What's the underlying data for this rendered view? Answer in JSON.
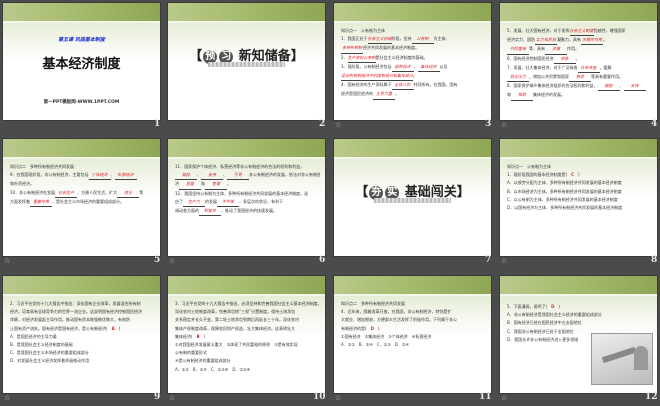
{
  "slides": [
    {
      "number": "1",
      "type": "title",
      "subtitle": "第五课 巩固基本制度",
      "title": "基本经济制度",
      "footer": "第一PPT模板网-WWW.1PPT.COM",
      "anim": false
    },
    {
      "number": "2",
      "type": "section",
      "left": "【",
      "c1": "预",
      "c2": "习",
      "title": "新知储备】",
      "anim": false
    },
    {
      "number": "3",
      "type": "text",
      "anim": true,
      "lines": [
        [
          {
            "t": "知识点一　公有制为主体"
          }
        ],
        [
          {
            "t": "1．我国正处于"
          },
          {
            "a": "社会主义初级"
          },
          {
            "t": "阶段，坚持"
          },
          {
            "a": "公有制"
          },
          {
            "t": "为主体、"
          }
        ],
        [
          {
            "a": "多种所有制"
          },
          {
            "t": "经济共同发展的基本经济制度。"
          }
        ],
        [
          {
            "t": "2．"
          },
          {
            "a": "生产资料公有制"
          },
          {
            "t": "是社会主义经济制度的基础。"
          }
        ],
        [
          {
            "t": "3．现阶段，公有制经济包括"
          },
          {
            "a": "国有经济"
          },
          {
            "t": "、"
          },
          {
            "a": "集体经济"
          },
          {
            "t": "以及"
          }
        ],
        [
          {
            "a": "混合所有制经济中的国有成分和集体成分"
          },
          {
            "t": "。"
          }
        ],
        [
          {
            "t": "4．国有经济的生产资料属于"
          },
          {
            "a": "全体人民"
          },
          {
            "t": "共同所有。在我国，国有"
          }
        ],
        [
          {
            "t": "经济是国民经济的"
          },
          {
            "a": "主导力量"
          },
          {
            "t": "。"
          }
        ]
      ]
    },
    {
      "number": "4",
      "type": "text",
      "anim": true,
      "lines": [
        [
          {
            "t": "5．发展、壮大国有经济，对于发挥"
          },
          {
            "a": "社会主义制度"
          },
          {
            "t": "优越性，增强国家"
          }
        ],
        [
          {
            "t": "经济实力、国防"
          },
          {
            "a": "实力和民族"
          },
          {
            "t": "凝聚力，具有"
          },
          {
            "a": "关键性作用"
          },
          {
            "t": "。"
          }
        ],
        [
          {
            "a": "共同富裕"
          },
          {
            "t": "等，具有"
          },
          {
            "a": "关键"
          },
          {
            "t": "作用。"
          }
        ],
        [
          {
            "t": "6．国有经济控制国民经济"
          },
          {
            "a": "命脉"
          },
          {
            "t": "。"
          }
        ],
        [
          {
            "t": "7．发展、壮大集体经济，对于广泛吸收"
          },
          {
            "a": "社会资金"
          },
          {
            "t": "，缓解"
          }
        ],
        [
          {
            "a": "就业压力"
          },
          {
            "t": "，增加公共积累和国家"
          },
          {
            "a": "税收"
          },
          {
            "t": "等具有重要作用。"
          }
        ],
        [
          {
            "t": "8．国家保护城乡集体经济组织的合法权利和利益，"
          },
          {
            "a": "鼓励"
          },
          {
            "t": "、"
          },
          {
            "a": "支持"
          }
        ],
        [
          {
            "t": "和"
          },
          {
            "a": "帮助"
          },
          {
            "t": "集体经济的发展。"
          }
        ]
      ]
    },
    {
      "number": "5",
      "type": "text",
      "anim": true,
      "lines": [
        [
          {
            "t": "知识点二　多种所有制经济共同发展"
          }
        ],
        [
          {
            "t": "9．在我国现阶段，非公有制经济，主要包括"
          },
          {
            "a": "个体经济"
          },
          {
            "t": "、"
          },
          {
            "a": "私营经济"
          }
        ],
        [
          {
            "t": "和外资经济。"
          }
        ],
        [
          {
            "t": "10．非公有制经济在发展"
          },
          {
            "a": "社会生产"
          },
          {
            "t": "、方便人民生活、扩大"
          },
          {
            "a": "就业"
          },
          {
            "t": "等"
          }
        ],
        [
          {
            "t": "方面发挥着"
          },
          {
            "a": "重要作用"
          },
          {
            "t": "，是社会主义市场经济的重要组成部分。"
          }
        ]
      ]
    },
    {
      "number": "6",
      "type": "text",
      "anim": true,
      "lines": [
        [
          {
            "t": "11．国家保护个体经济、私营经济等非公有制经济的合法的权利和利益，"
          }
        ],
        [
          {
            "a": "鼓励"
          },
          {
            "t": "、"
          },
          {
            "a": "支持"
          },
          {
            "t": "、"
          },
          {
            "a": "引导"
          },
          {
            "t": "非公有制经济的发展，依法对非公有制经"
          }
        ],
        [
          {
            "t": "济"
          },
          {
            "a": "监督"
          },
          {
            "t": "和"
          },
          {
            "a": "管理"
          },
          {
            "t": "。"
          }
        ],
        [
          {
            "t": "12．我国坚持公有制为主体、多种所有制经济共同发展的基本经济制度，适"
          }
        ],
        [
          {
            "t": "应了"
          },
          {
            "a": "生产力"
          },
          {
            "t": "的发展"
          },
          {
            "a": "不平衡"
          },
          {
            "t": "，多层次的状况，有利于"
          }
        ],
        [
          {
            "t": "调动各方面的"
          },
          {
            "a": "积极性"
          },
          {
            "t": "，推动了我国经济的快速发展。"
          }
        ]
      ]
    },
    {
      "number": "7",
      "type": "section",
      "left": "【",
      "c1": "夯",
      "c2": "实",
      "title": "基础闯关】",
      "anim": false
    },
    {
      "number": "8",
      "type": "text",
      "anim": true,
      "lines": [
        [
          {
            "t": "知识点一　公有制为主体"
          }
        ],
        [
          {
            "t": "1．现阶段我国的基本经济制度是(　"
          },
          {
            "r": "C"
          },
          {
            "t": "　)"
          }
        ],
        [
          {
            "t": "A．以按劳分配为主体、多种所有制经济共同发展的基本经济制度"
          }
        ],
        [
          {
            "t": "B．以市场经济为主体、多种所有制经济共同发展的基本经济制度"
          }
        ],
        [
          {
            "t": "C．以公有制为主体、多种所有制经济共同发展的基本经济制度"
          }
        ],
        [
          {
            "t": "D．以国有经济为主体、多种所有制经济共同发展的基本经济制度"
          }
        ]
      ]
    },
    {
      "number": "9",
      "type": "text",
      "anim": true,
      "lines": [
        [
          {
            "t": "2．习近平在党的十九大报告中指出：深化国有企业改革，发展混合所有制"
          }
        ],
        [
          {
            "t": "经济，培育具有全球竞争力的世界一流企业。这说明国有经济控制国民经济"
          }
        ],
        [
          {
            "t": "命脉，对经济发展起主导作用。推动国有资本做强做优做大，有效防"
          }
        ],
        [
          {
            "t": "止国有资产流失。国有经济是国有经济，是公有制经济(　"
          },
          {
            "r": "A"
          },
          {
            "t": "　)"
          }
        ],
        [
          {
            "t": "A．是国民经济的主导力量"
          }
        ],
        [
          {
            "t": "B．是我国社会主义经济制度的基础"
          }
        ],
        [
          {
            "t": "C．是我国社会主义市场经济的重要组成部分"
          }
        ],
        [
          {
            "t": "D．对发展社会主义经济发挥着积极推动作用"
          }
        ]
      ]
    },
    {
      "number": "10",
      "type": "text",
      "anim": true,
      "lines": [
        [
          {
            "t": "3．习近平在党的十九大报告中指出，必须坚持和完善我国社会主义基本经济制度，"
          }
        ],
        [
          {
            "t": "深化农村土地制度改革，完善承包地“三权”分置制度。保持土地承包"
          }
        ],
        [
          {
            "t": "关系稳定并长久不变，第二轮土地承包到期后再延长三十年。深化农村"
          }
        ],
        [
          {
            "t": "集体产权制度改革，保障农民财产权益，壮大集体经济。这表明壮大"
          }
        ],
        [
          {
            "t": "集体经济(　"
          },
          {
            "r": "B"
          },
          {
            "t": "　)"
          }
        ],
        [
          {
            "t": "①对我国经济发展意义重大　②体现了共同富裕的原则　③是有效实现"
          }
        ],
        [
          {
            "t": "公有制的重要形式"
          }
        ],
        [
          {
            "t": "④是公有制经济的重要组成部分"
          }
        ],
        [
          {
            "t": "A．①②　B．①④　C．②③④　D．①③④"
          }
        ]
      ]
    },
    {
      "number": "11",
      "type": "text",
      "anim": true,
      "lines": [
        [
          {
            "t": "知识点二　多种所有制经济共同发展"
          }
        ],
        [
          {
            "t": "4．近年来，随着改革开放，在我国，非公有制经济，特别是扩"
          }
        ],
        [
          {
            "t": "大就业、增加税收，方便群众生活发挥了积极作用。下列属于非公"
          }
        ],
        [
          {
            "t": "有制经济的是(　"
          },
          {
            "r": "D"
          },
          {
            "t": "　)"
          }
        ],
        [
          {
            "t": "①国有经济　②集体经济　③个体经济　④私营经济"
          }
        ],
        [
          {
            "t": "A．①②　B．③④　C．①③　D．②④"
          }
        ]
      ]
    },
    {
      "number": "12",
      "type": "text",
      "anim": true,
      "cartoon": true,
      "lines": [
        [
          {
            "t": "5．下面漫画，说明了(　"
          },
          {
            "r": "D"
          },
          {
            "t": "　)"
          }
        ],
        [
          {
            "t": "A．非公有制经济是我国社会主义经济的重要组成部分"
          }
        ],
        [
          {
            "t": "B．国有经济已经在国民经济中占支配地位"
          }
        ],
        [
          {
            "t": "C．我国非公有制经济已处于支配地位"
          }
        ],
        [
          {
            "t": "D．我国允许非公有制经济进入更多领域"
          }
        ]
      ]
    }
  ],
  "anim_icon": "animation-icon"
}
